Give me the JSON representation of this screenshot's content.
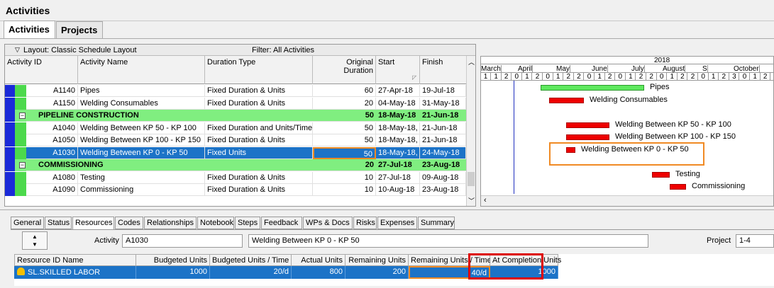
{
  "window": {
    "title": "Activities"
  },
  "tabs": [
    {
      "label": "Activities"
    },
    {
      "label": "Projects"
    }
  ],
  "toolbar": {
    "layout": "Layout: Classic Schedule Layout",
    "filter": "Filter: All Activities"
  },
  "columns": {
    "activity_id": "Activity ID",
    "activity_name": "Activity Name",
    "duration_type": "Duration Type",
    "original_duration": "Original Duration",
    "start": "Start",
    "finish": "Finish"
  },
  "rows": [
    {
      "kind": "activity",
      "id": "A1140",
      "name": "Pipes",
      "dtype": "Fixed Duration & Units",
      "dur": "60",
      "start": "27-Apr-18",
      "finish": "19-Jul-18"
    },
    {
      "kind": "activity",
      "id": "A1150",
      "name": "Welding Consumables",
      "dtype": "Fixed Duration & Units",
      "dur": "20",
      "start": "04-May-18",
      "finish": "31-May-18"
    },
    {
      "kind": "wbs",
      "name": "PIPELINE CONSTRUCTION",
      "dur": "50",
      "start": "18-May-18",
      "finish": "21-Jun-18"
    },
    {
      "kind": "activity",
      "id": "A1040",
      "name": "Welding Between KP 50 - KP 100",
      "dtype": "Fixed Duration and Units/Time",
      "dur": "50",
      "start": "18-May-18,",
      "finish": "21-Jun-18"
    },
    {
      "kind": "activity",
      "id": "A1050",
      "name": "Welding Between KP 100 - KP 150",
      "dtype": "Fixed Duration & Units",
      "dur": "50",
      "start": "18-May-18,",
      "finish": "21-Jun-18"
    },
    {
      "kind": "selected",
      "id": "A1030",
      "name": "Welding Between KP 0 - KP 50",
      "dtype": "Fixed Units",
      "dur": "50",
      "start": "18-May-18,",
      "finish": "24-May-18"
    },
    {
      "kind": "wbs",
      "name": "COMMISSIONING",
      "dur": "20",
      "start": "27-Jul-18",
      "finish": "23-Aug-18"
    },
    {
      "kind": "activity",
      "id": "A1080",
      "name": "Testing",
      "dtype": "Fixed Duration & Units",
      "dur": "10",
      "start": "27-Jul-18",
      "finish": "09-Aug-18"
    },
    {
      "kind": "activity",
      "id": "A1090",
      "name": "Commissioning",
      "dtype": "Fixed Duration & Units",
      "dur": "10",
      "start": "10-Aug-18",
      "finish": "23-Aug-18"
    }
  ],
  "gantt": {
    "year": "2018",
    "months": [
      "March",
      "April",
      "May",
      "June",
      "July",
      "August",
      "S",
      "October"
    ],
    "weeks": [
      "1",
      "1",
      "2",
      "0",
      "1",
      "2",
      "0",
      "1",
      "2",
      "2",
      "0",
      "1",
      "2",
      "0",
      "1",
      "2",
      "2",
      "0",
      "1",
      "2",
      "2",
      "0",
      "1",
      "2",
      "3",
      "0",
      "1",
      "2"
    ],
    "bars": [
      {
        "label": "Pipes",
        "color": "#5ee85e"
      },
      {
        "label": "Welding Consumables",
        "color": "#ee0000"
      },
      {
        "label": "Welding Between KP 50 - KP 100",
        "color": "#ee0000"
      },
      {
        "label": "Welding Between KP 100 - KP 150",
        "color": "#ee0000"
      },
      {
        "label": "Welding Between KP 0 - KP 50",
        "color": "#ee0000"
      },
      {
        "label": "Testing",
        "color": "#ee0000"
      },
      {
        "label": "Commissioning",
        "color": "#ee0000"
      }
    ]
  },
  "details": {
    "tabs": [
      "General",
      "Status",
      "Resources",
      "Codes",
      "Relationships",
      "Notebook",
      "Steps",
      "Feedback",
      "WPs & Docs",
      "Risks",
      "Expenses",
      "Summary"
    ],
    "active_tab": "Resources",
    "activity_label": "Activity",
    "activity_id": "A1030",
    "activity_name": "Welding Between KP 0 - KP 50",
    "project_label": "Project",
    "project_value": "1-4",
    "res_columns": [
      "Resource ID Name",
      "Budgeted Units",
      "Budgeted Units / Time",
      "Actual Units",
      "Remaining Units",
      "Remaining Units / Time",
      "At Completion Units"
    ],
    "res_row": {
      "resource": "SL.SKILLED LABOR",
      "budgeted": "1000",
      "budgeted_time": "20/d",
      "actual": "800",
      "remaining": "200",
      "remaining_time": "40/d",
      "at_completion": "1000"
    }
  },
  "colors": {
    "selection": "#1c73c7",
    "wbs_band": "#80ee80",
    "highlight_orange": "#f08a24",
    "highlight_red": "#dd0000"
  }
}
